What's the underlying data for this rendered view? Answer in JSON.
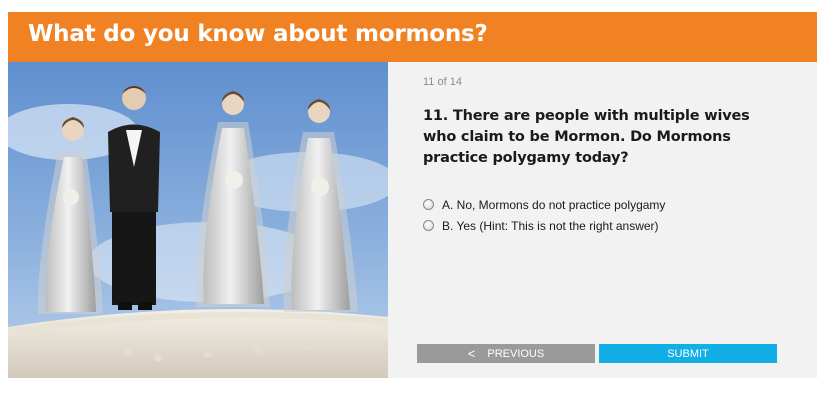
{
  "quiz": {
    "title": "What do you know about mormons?",
    "counter": "11 of 14",
    "question": "11. There are people with multiple wives who claim to be Mormon. Do Mormons practice polygamy today?",
    "options": [
      {
        "label": "A. No, Mormons do not practice polygamy",
        "selected": false
      },
      {
        "label": "B. Yes (Hint: This is not the right answer)",
        "selected": false
      }
    ],
    "buttons": {
      "previous_icon": "<",
      "previous_label": "PREVIOUS",
      "submit_label": "SUBMIT"
    },
    "colors": {
      "header": "#f08224",
      "panel": "#f2f2f2",
      "previous_button": "#9a9a9a",
      "submit_button": "#12aee6"
    }
  }
}
